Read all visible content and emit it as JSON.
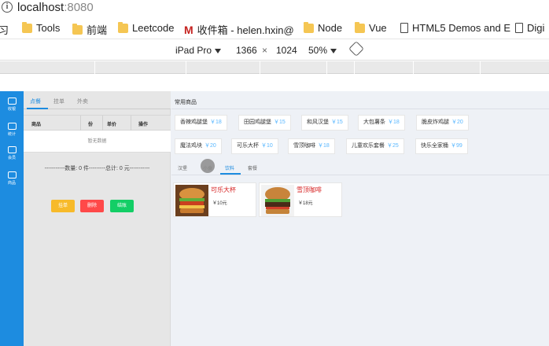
{
  "browser": {
    "url_host": "localhost",
    "url_port": ":8080",
    "bookmarks": [
      {
        "label": "习",
        "kind": "text"
      },
      {
        "label": "Tools",
        "kind": "folder"
      },
      {
        "label": "前端",
        "kind": "folder"
      },
      {
        "label": "Leetcode",
        "kind": "folder"
      },
      {
        "label": "收件箱 - helen.hxin@",
        "kind": "gmail"
      },
      {
        "label": "Node",
        "kind": "folder"
      },
      {
        "label": "Vue",
        "kind": "folder"
      },
      {
        "label": "HTML5 Demos and E",
        "kind": "doc"
      },
      {
        "label": "Digi",
        "kind": "doc"
      }
    ],
    "device": "iPad Pro",
    "width": "1366",
    "times": "×",
    "height": "1024",
    "zoom": "50%"
  },
  "nav": [
    {
      "label": "收银",
      "icon": "cashier-icon"
    },
    {
      "label": "统计",
      "icon": "stats-icon"
    },
    {
      "label": "会员",
      "icon": "member-icon"
    },
    {
      "label": "商品",
      "icon": "goods-icon"
    }
  ],
  "order": {
    "tabs": [
      "点餐",
      "挂单",
      "外卖"
    ],
    "columns": [
      "商品",
      "份",
      "单价",
      "操作"
    ],
    "empty_text": "暂无数据",
    "summary": "-----------数量: 0 件---------总计: 0 元-----------",
    "buttons": [
      {
        "label": "挂单",
        "color": "#f7ba2a"
      },
      {
        "label": "删除",
        "color": "#ff4949"
      },
      {
        "label": "结账",
        "color": "#13ce66"
      }
    ]
  },
  "goods": {
    "section_title": "常用商品",
    "frequent": [
      {
        "name": "香辣鸡腿堡",
        "price": "￥18"
      },
      {
        "name": "田园鸡腿堡",
        "price": "￥15"
      },
      {
        "name": "和风汉堡",
        "price": "￥15"
      },
      {
        "name": "大包薯条",
        "price": "￥18"
      },
      {
        "name": "脆皮炸鸡腿",
        "price": "￥20"
      },
      {
        "name": "魔法鸡块",
        "price": "￥20"
      },
      {
        "name": "可乐大杯",
        "price": "￥10"
      },
      {
        "name": "雪顶咖啡",
        "price": "￥18"
      },
      {
        "name": "儿童欢乐套餐",
        "price": "￥25"
      },
      {
        "name": "快乐全家桶",
        "price": "￥99"
      }
    ],
    "category_tabs": [
      "汉堡",
      "小食",
      "饮料",
      "套餐"
    ],
    "active_category": "饮料",
    "cards": [
      {
        "name": "可乐大杯",
        "price": "￥10元"
      },
      {
        "name": "雪顶咖啡",
        "price": "￥18元"
      }
    ]
  },
  "colors": {
    "accent": "#1d8ce0",
    "price": "#58b7ff"
  }
}
